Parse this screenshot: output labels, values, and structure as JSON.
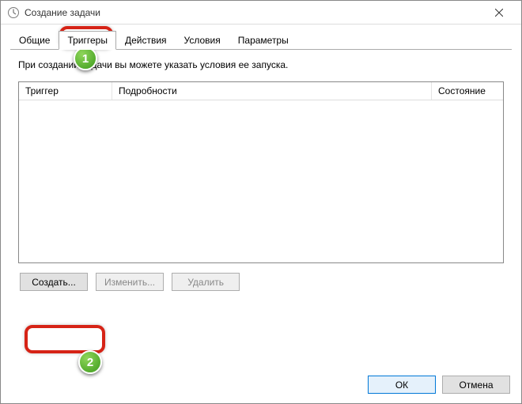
{
  "titlebar": {
    "title": "Создание задачи"
  },
  "tabs": {
    "general": "Общие",
    "triggers": "Триггеры",
    "actions": "Действия",
    "conditions": "Условия",
    "settings": "Параметры"
  },
  "panel": {
    "description": "При создании задачи вы можете указать условия ее запуска."
  },
  "columns": {
    "trigger": "Триггер",
    "details": "Подробности",
    "state": "Состояние"
  },
  "buttons": {
    "create": "Создать...",
    "edit": "Изменить...",
    "delete": "Удалить"
  },
  "footer": {
    "ok": "ОК",
    "cancel": "Отмена"
  },
  "markers": {
    "m1": "1",
    "m2": "2"
  }
}
